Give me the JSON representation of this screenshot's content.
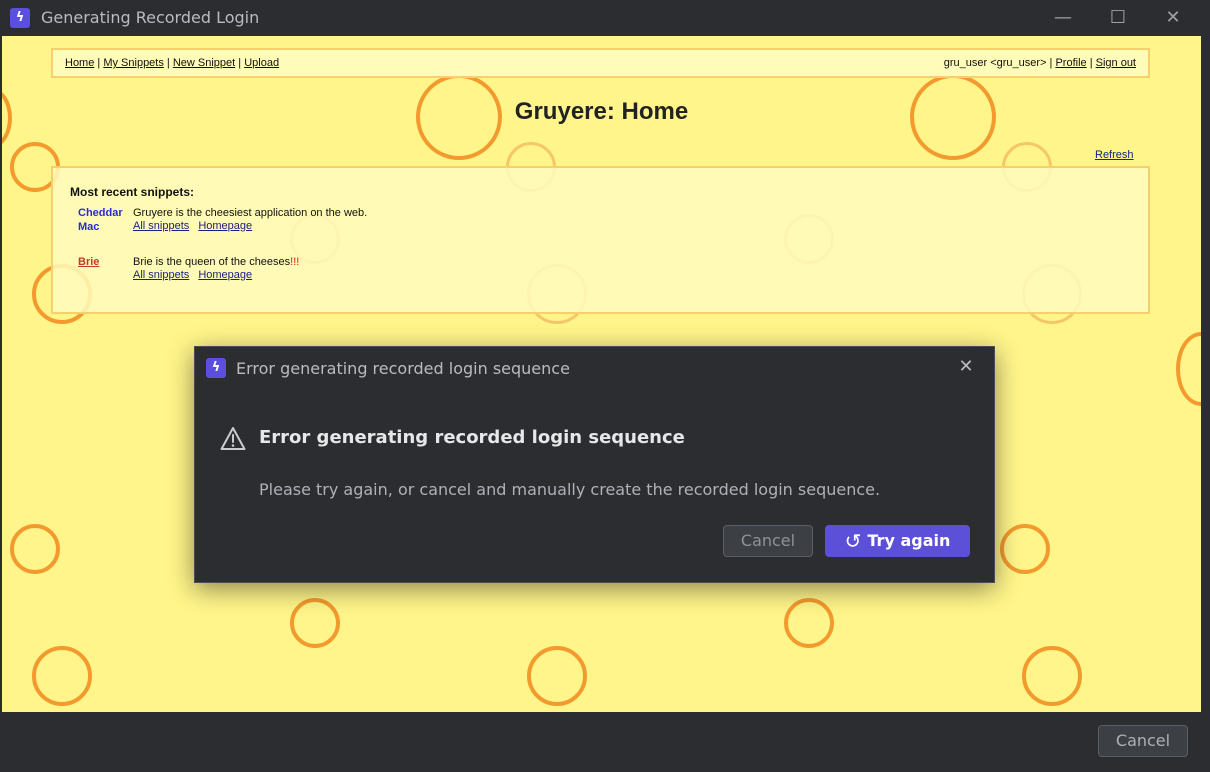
{
  "window": {
    "title": "Generating Recorded Login",
    "logo_icon": "lightning-bolt-icon",
    "minimize_glyph": "—",
    "maximize_glyph": "☐",
    "close_glyph": "✕"
  },
  "gruyere": {
    "nav": {
      "home": "Home",
      "my_snippets": "My Snippets",
      "new_snippet": "New Snippet",
      "upload": "Upload",
      "user": "gru_user <gru_user>",
      "profile": "Profile",
      "sign_out": "Sign out",
      "separator": "|"
    },
    "title": "Gruyere: Home",
    "refresh": "Refresh",
    "snippets_heading": "Most recent snippets:",
    "snippets": [
      {
        "author": "Cheddar Mac",
        "text": "Gruyere is the cheesiest application on the web.",
        "all_snippets": "All snippets",
        "homepage": "Homepage"
      },
      {
        "author": "Brie",
        "text": "Brie is the queen of the cheeses",
        "emphasis": "!!!",
        "all_snippets": "All snippets",
        "homepage": "Homepage"
      }
    ],
    "colors": {
      "background": "#fff88f",
      "hole": "#f39a2e",
      "link_blue": "#2b2bd0",
      "link_red": "#c0392b"
    }
  },
  "dialog": {
    "titlebar": "Error generating recorded login sequence",
    "heading": "Error generating recorded login sequence",
    "message": "Please try again, or cancel and manually create the recorded login sequence.",
    "cancel_label": "Cancel",
    "try_again_label": "Try again",
    "warning_icon": "warning-triangle-icon",
    "retry_icon": "retry-icon",
    "accent": "#5c50d8"
  },
  "footer": {
    "cancel_label": "Cancel"
  }
}
